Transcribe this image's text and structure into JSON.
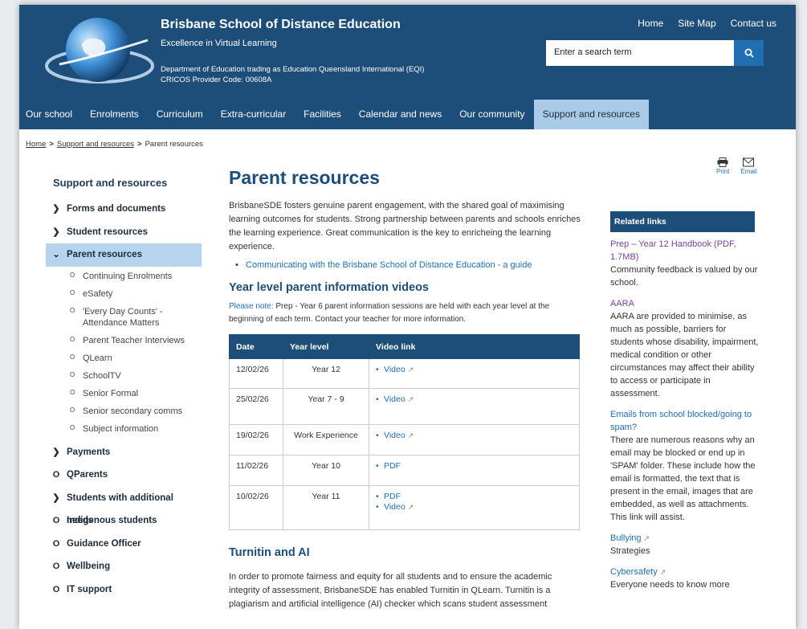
{
  "header": {
    "school_name": "Brisbane School of Distance Education",
    "tagline": "Excellence in Virtual Learning",
    "dept_line1": "Department of Education trading as Education Queensland International (EQI)",
    "dept_line2": "CRICOS Provider Code: 00608A",
    "top_links": [
      "Home",
      "Site Map",
      "Contact us"
    ],
    "search_placeholder": "Enter a search term"
  },
  "nav": [
    "Our school",
    "Enrolments",
    "Curriculum",
    "Extra-curricular",
    "Facilities",
    "Calendar and news",
    "Our community",
    "Support and resources"
  ],
  "breadcrumb": [
    "Home",
    "Support and resources",
    "Parent resources"
  ],
  "sidebar": {
    "title": "Support and resources",
    "items": [
      {
        "label": "Forms and documents",
        "icon": "chevron-right"
      },
      {
        "label": "Student resources",
        "icon": "chevron-right"
      },
      {
        "label": "Parent resources",
        "icon": "chevron-down",
        "active": true,
        "children": [
          "Continuing Enrolments",
          "eSafety",
          "'Every Day Counts' - Attendance Matters",
          "Parent Teacher Interviews",
          "QLearn",
          "SchoolTV",
          "Senior Formal",
          "Senior secondary comms",
          "Subject information"
        ]
      },
      {
        "label": "Payments",
        "icon": "chevron-right"
      },
      {
        "label": "QParents",
        "icon": "circle"
      },
      {
        "label": "Students with additional needs",
        "icon": "chevron-right"
      },
      {
        "label": "Indigenous students",
        "icon": "circle"
      },
      {
        "label": "Guidance Officer",
        "icon": "circle"
      },
      {
        "label": "Wellbeing",
        "icon": "circle"
      },
      {
        "label": "IT support",
        "icon": "circle"
      }
    ]
  },
  "main": {
    "title": "Parent resources",
    "intro": "BrisbaneSDE fosters genuine parent engagement, with the shared goal of maximising learning outcomes for students.  Strong partnership between parents and schools enriches the learning experience. Great communication is the key to enricheing the learning experience.",
    "guide_link": "Communicating with the Brisbane School of Distance Education - a guide",
    "videos_heading": "Year level parent information videos",
    "note_label": "Please note:",
    "note_text": " Prep - Year 6 parent  information sessions are held with each year level at the beginning of each term. Contact your teacher for more information.",
    "table": {
      "headers": [
        "Date",
        "Year level",
        "Video link"
      ],
      "rows": [
        {
          "date": "12/02/26",
          "year": "Year 12",
          "links": [
            "Video"
          ]
        },
        {
          "date": "25/02/26",
          "year": "Year 7 - 9",
          "links": [
            "Video"
          ]
        },
        {
          "date": "19/02/26",
          "year": "Work Experience",
          "links": [
            "Video"
          ]
        },
        {
          "date": "11/02/26",
          "year": "Year 10",
          "links": [
            "PDF"
          ]
        },
        {
          "date": "10/02/26",
          "year": "Year 11",
          "links": [
            "PDF",
            "Video"
          ]
        }
      ]
    },
    "turnitin_heading": "Turnitin and AI",
    "turnitin_text": "In order to promote fairness and equity for all students and to ensure the academic integrity of assessment, BrisbaneSDE has enabled Turnitin in QLearn. Turnitin is a plagiarism and artificial intelligence (AI) checker which scans student assessment"
  },
  "tools": {
    "print": "Print",
    "email": "Email"
  },
  "related": {
    "heading": "Related links",
    "items": [
      {
        "link": "Prep – Year 12 Handbook (PDF, 1.7MB)",
        "desc": "Community feedback is valued by our school.",
        "color": "purple"
      },
      {
        "link": "AARA",
        "desc": "AARA are provided to minimise, as much as possible, barriers for students whose disability, impairment, medical condition or other circumstances may affect their ability to access or participate in assessment.",
        "color": "purple"
      },
      {
        "link": "Emails from school blocked/going to spam?",
        "desc": "There are numerous reasons why an email may be blocked or end up in 'SPAM' folder. These include how the email is formatted, the text that is present in the email, images that are embedded, as well as attachments. This link will assist.",
        "color": "blue"
      },
      {
        "link": "Bullying",
        "desc": "Strategies",
        "color": "blue",
        "external": true
      },
      {
        "link": "Cybersafety",
        "desc": "Everyone needs to know more",
        "color": "blue",
        "external": true
      }
    ]
  }
}
